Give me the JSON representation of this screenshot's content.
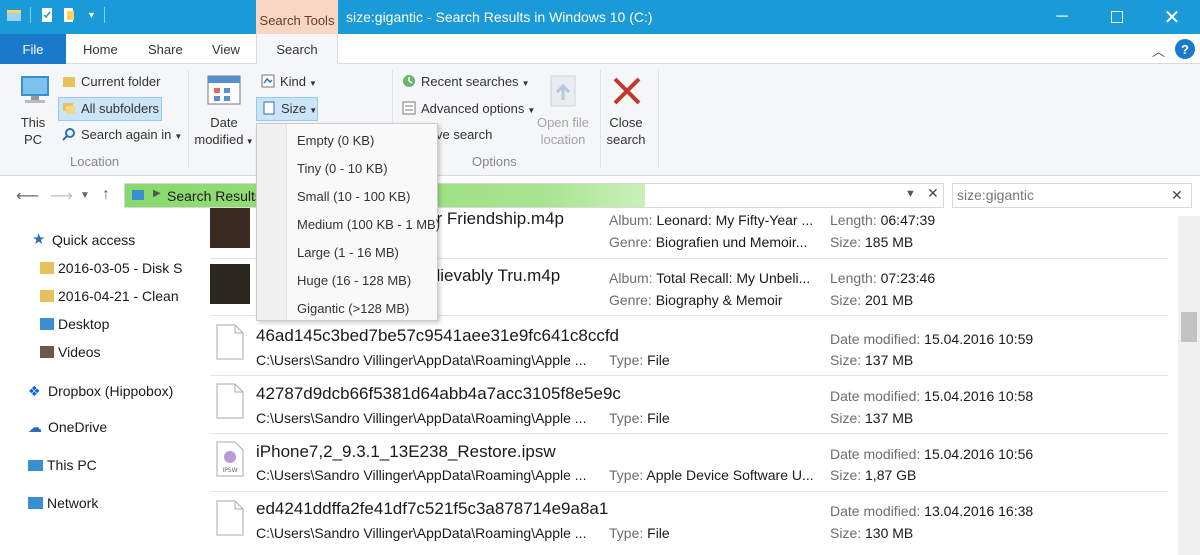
{
  "window": {
    "title": "size:gigantic - Search Results in Windows 10 (C:)",
    "context_tab": "Search Tools"
  },
  "ribbon_tabs": {
    "file": "File",
    "home": "Home",
    "share": "Share",
    "view": "View",
    "search": "Search"
  },
  "ribbon": {
    "this_pc": "This PC",
    "current_folder": "Current folder",
    "all_subfolders": "All subfolders",
    "search_again_in": "Search again in",
    "location_group": "Location",
    "date_modified": "Date modified",
    "kind": "Kind",
    "size": "Size",
    "recent_searches": "Recent searches",
    "advanced_options": "Advanced options",
    "save_search": "ve search",
    "options_group": "Options",
    "open_file_location": "Open file location",
    "close_search": "Close search"
  },
  "size_menu": {
    "items": [
      "Empty (0 KB)",
      "Tiny (0 - 10 KB)",
      "Small (10 - 100 KB)",
      "Medium (100 KB - 1 MB)",
      "Large (1 - 16 MB)",
      "Huge (16 - 128 MB)",
      "Gigantic (>128 MB)"
    ]
  },
  "address": {
    "path": "Search Results",
    "search_value": "size:gigantic"
  },
  "nav": {
    "items": [
      "Quick access",
      "2016-03-05 - Disk S",
      "2016-04-21 - Clean",
      "Desktop",
      "Videos",
      "Dropbox (Hippobox)",
      "OneDrive",
      "This PC",
      "Network"
    ]
  },
  "results": [
    {
      "name": "ar Friendship.m4p",
      "line2": "",
      "k1": "Album: ",
      "v1": "Leonard: My Fifty-Year ...",
      "k2": "Genre: ",
      "v2": "Biografien und Memoir...",
      "k3": "Length: ",
      "v3": "06:47:39",
      "k4": "Size: ",
      "v4": "185 MB"
    },
    {
      "name": "elievably Tru.m4p",
      "line2": "",
      "k1": "Album: ",
      "v1": "Total Recall: My Unbeli...",
      "k2": "Genre: ",
      "v2": "Biography & Memoir",
      "k3": "Length: ",
      "v3": "07:23:46",
      "k4": "Size: ",
      "v4": "201 MB"
    },
    {
      "name": "46ad145c3bed7be57c9541aee31e9fc641c8ccfd",
      "line2": "C:\\Users\\Sandro Villinger\\AppData\\Roaming\\Apple ...",
      "k2": "Type: ",
      "v2": "File",
      "k3": "Date modified: ",
      "v3": "15.04.2016 10:59",
      "k4": "Size: ",
      "v4": "137 MB"
    },
    {
      "name": "42787d9dcb66f5381d64abb4a7acc3105f8e5e9c",
      "line2": "C:\\Users\\Sandro Villinger\\AppData\\Roaming\\Apple ...",
      "k2": "Type: ",
      "v2": "File",
      "k3": "Date modified: ",
      "v3": "15.04.2016 10:58",
      "k4": "Size: ",
      "v4": "137 MB"
    },
    {
      "name": "iPhone7,2_9.3.1_13E238_Restore.ipsw",
      "line2": "C:\\Users\\Sandro Villinger\\AppData\\Roaming\\Apple ...",
      "k2": "Type: ",
      "v2": "Apple Device Software U...",
      "k3": "Date modified: ",
      "v3": "15.04.2016 10:56",
      "k4": "Size: ",
      "v4": "1,87 GB"
    },
    {
      "name": "ed4241ddffa2fe41df7c521f5c3a878714e9a8a1",
      "line2": "C:\\Users\\Sandro Villinger\\AppData\\Roaming\\Apple ...",
      "k2": "Type: ",
      "v2": "File",
      "k3": "Date modified: ",
      "v3": "13.04.2016 16:38",
      "k4": "Size: ",
      "v4": "130 MB"
    }
  ],
  "colors": {
    "titlebar": "#1a9ad6",
    "file_tab": "#1979ca",
    "context_tab": "#f7d7c4",
    "selection": "#cce4f7"
  }
}
